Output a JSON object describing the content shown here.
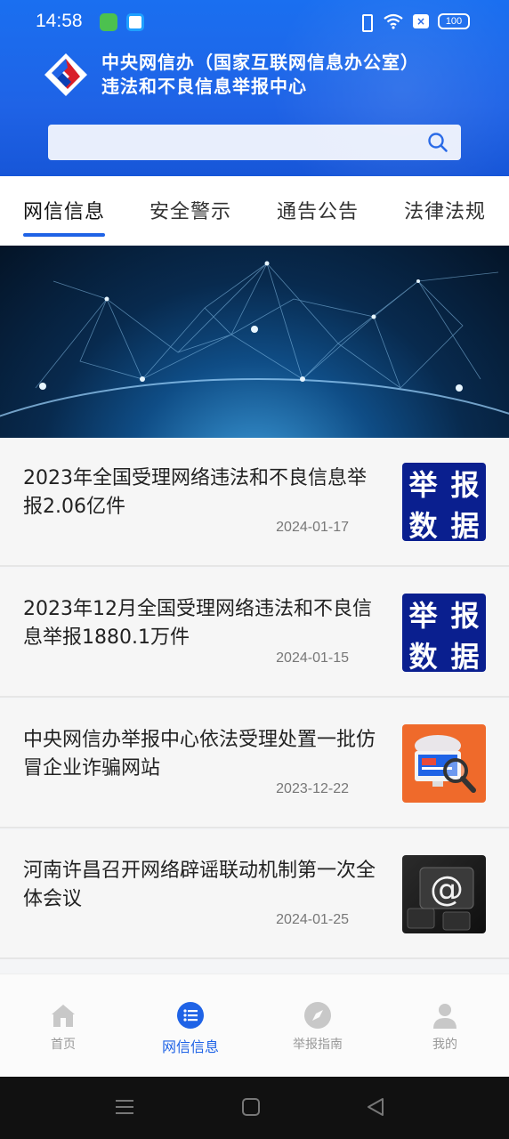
{
  "status_bar": {
    "time": "14:58",
    "battery": "100"
  },
  "header": {
    "title_line1": "中央网信办（国家互联网信息办公室）",
    "title_line2": "违法和不良信息举报中心",
    "search_placeholder": ""
  },
  "tabs": [
    {
      "label": "网信信息",
      "active": true
    },
    {
      "label": "安全警示",
      "active": false
    },
    {
      "label": "通告公告",
      "active": false
    },
    {
      "label": "法律法规",
      "active": false
    }
  ],
  "news": [
    {
      "title": "2023年全国受理网络违法和不良信息举报2.06亿件",
      "date": "2024-01-17",
      "thumb": "report-data",
      "thumb_chars": [
        "举",
        "报",
        "数",
        "据"
      ]
    },
    {
      "title": "2023年12月全国受理网络违法和不良信息举报1880.1万件",
      "date": "2024-01-15",
      "thumb": "report-data",
      "thumb_chars": [
        "举",
        "报",
        "数",
        "据"
      ]
    },
    {
      "title": "中央网信办举报中心依法受理处置一批仿冒企业诈骗网站",
      "date": "2023-12-22",
      "thumb": "magnifier-computer"
    },
    {
      "title": "河南许昌召开网络辟谣联动机制第一次全体会议",
      "date": "2024-01-25",
      "thumb": "at-key"
    }
  ],
  "bottom_nav": [
    {
      "label": "首页",
      "icon": "home-icon",
      "active": false
    },
    {
      "label": "网信信息",
      "icon": "list-icon",
      "active": true
    },
    {
      "label": "举报指南",
      "icon": "compass-icon",
      "active": false
    },
    {
      "label": "我的",
      "icon": "user-icon",
      "active": false
    }
  ],
  "colors": {
    "brand_blue": "#1f63e6",
    "thumb_navy": "#0a1f8f",
    "thumb_orange": "#ef6a2b"
  }
}
